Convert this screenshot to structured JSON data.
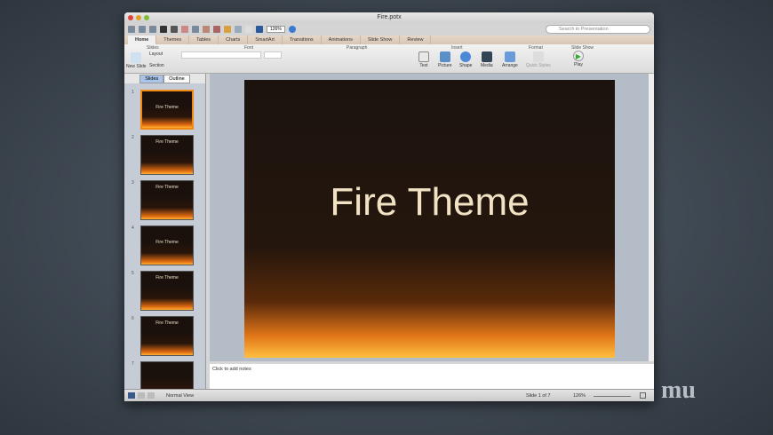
{
  "window": {
    "title": "Fire.potx"
  },
  "toolbar": {
    "zoom": "126%",
    "search_placeholder": "Search in Presentation"
  },
  "tabs": [
    "Home",
    "Themes",
    "Tables",
    "Charts",
    "SmartArt",
    "Transitions",
    "Animations",
    "Slide Show",
    "Review"
  ],
  "ribbon": {
    "groups": [
      "Slides",
      "Font",
      "Paragraph",
      "Insert",
      "Format",
      "Slide Show"
    ],
    "new_slide": "New Slide",
    "layout": "Layout",
    "section": "Section",
    "insert": [
      "Text",
      "Picture",
      "Shape",
      "Media",
      "Arrange"
    ],
    "quick_styles": "Quick Styles",
    "play": "Play"
  },
  "sidebar": {
    "tabs": [
      "Slides",
      "Outline"
    ],
    "slides": [
      {
        "num": "1",
        "title": "Fire Theme"
      },
      {
        "num": "2",
        "title": "Fire Theme"
      },
      {
        "num": "3",
        "title": "Fire Theme"
      },
      {
        "num": "4",
        "title": "Fire Theme"
      },
      {
        "num": "5",
        "title": "Fire Theme"
      },
      {
        "num": "6",
        "title": "Fire Theme"
      },
      {
        "num": "7",
        "title": ""
      }
    ]
  },
  "slide": {
    "title": "Fire Theme"
  },
  "notes": {
    "placeholder": "Click to add notes"
  },
  "status": {
    "view": "Normal View",
    "slide": "Slide 1 of 7",
    "zoom": "126%"
  },
  "watermark": "mu"
}
